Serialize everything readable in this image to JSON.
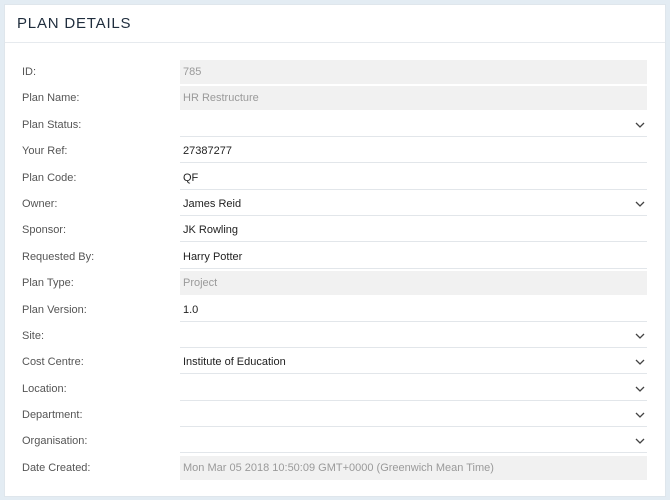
{
  "panel": {
    "title": "PLAN DETAILS"
  },
  "fields": [
    {
      "label": "ID:",
      "value": "785",
      "readonly": true,
      "dropdown": false
    },
    {
      "label": "Plan Name:",
      "value": "HR Restructure",
      "readonly": true,
      "dropdown": false
    },
    {
      "label": "Plan Status:",
      "value": "",
      "readonly": false,
      "dropdown": true
    },
    {
      "label": "Your Ref:",
      "value": "27387277",
      "readonly": false,
      "dropdown": false
    },
    {
      "label": "Plan Code:",
      "value": "QF",
      "readonly": false,
      "dropdown": false
    },
    {
      "label": "Owner:",
      "value": "James Reid",
      "readonly": false,
      "dropdown": true
    },
    {
      "label": "Sponsor:",
      "value": "JK Rowling",
      "readonly": false,
      "dropdown": false
    },
    {
      "label": "Requested By:",
      "value": "Harry Potter",
      "readonly": false,
      "dropdown": false
    },
    {
      "label": "Plan Type:",
      "value": "Project",
      "readonly": true,
      "dropdown": false
    },
    {
      "label": "Plan Version:",
      "value": "1.0",
      "readonly": false,
      "dropdown": false
    },
    {
      "label": "Site:",
      "value": "",
      "readonly": false,
      "dropdown": true
    },
    {
      "label": "Cost Centre:",
      "value": "Institute of Education",
      "readonly": false,
      "dropdown": true
    },
    {
      "label": "Location:",
      "value": "",
      "readonly": false,
      "dropdown": true
    },
    {
      "label": "Department:",
      "value": "",
      "readonly": false,
      "dropdown": true
    },
    {
      "label": "Organisation:",
      "value": "",
      "readonly": false,
      "dropdown": true
    },
    {
      "label": "Date Created:",
      "value": "Mon Mar 05 2018 10:50:09 GMT+0000 (Greenwich Mean Time)",
      "readonly": true,
      "dropdown": false
    }
  ],
  "icons": {
    "dropdown": "chevron-down-icon"
  },
  "colors": {
    "readonly_bg": "#f1f1f1",
    "page_bg": "#e3ecf3"
  }
}
